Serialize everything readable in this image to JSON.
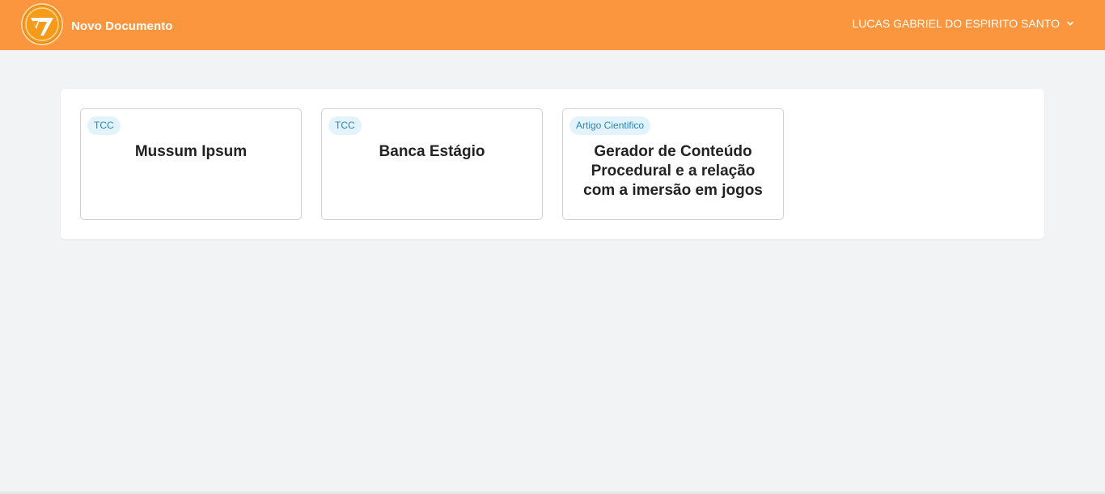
{
  "header": {
    "new_document_label": "Novo Documento",
    "user_name": "LUCAS GABRIEL DO ESPIRITO SANTO",
    "user_menu_icon": "chevron-down-icon",
    "logo_icon": "app-logo-icon"
  },
  "documents": [
    {
      "tag": "TCC",
      "title": "Mussum Ipsum"
    },
    {
      "tag": "TCC",
      "title": "Banca Estágio"
    },
    {
      "tag": "Artigo Cientifico",
      "title": "Gerador de Conteúdo Procedural e a relação com a imersão em jogos"
    }
  ],
  "colors": {
    "header_bg": "#fb953e",
    "page_bg": "#f2f3f5",
    "tag_bg": "#e3f3fb",
    "tag_text": "#2a87b8"
  }
}
